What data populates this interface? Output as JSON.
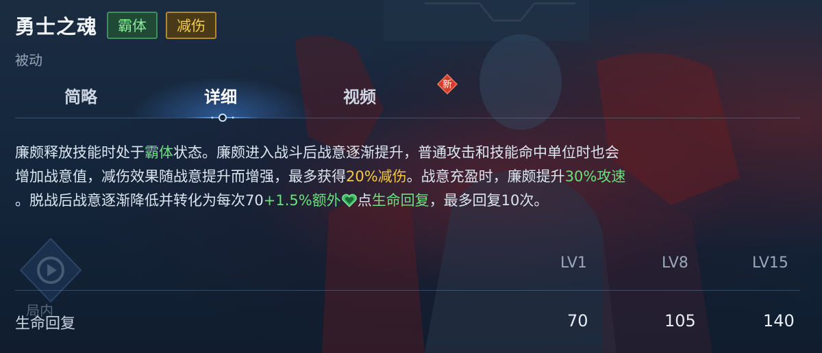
{
  "skill": {
    "name": "勇士之魂",
    "tags": [
      "霸体",
      "减伤"
    ],
    "type": "被动"
  },
  "tabs": [
    {
      "label": "简略",
      "active": false
    },
    {
      "label": "详细",
      "active": true
    },
    {
      "label": "视频",
      "active": false
    }
  ],
  "new_badge": "新",
  "description": {
    "line1_a": "廉颇释放技能时处于",
    "line1_hl": "霸体",
    "line1_b": "状态。廉颇进入战斗后战意逐渐提升，普通攻击和技能命中单位时也会",
    "line2_a": "增加战意值，减伤效果随战意提升而增强，最多获得",
    "line2_hl": "20%减伤",
    "line2_b": "。战意充盈时，廉颇提升",
    "line2_hl2": "30%攻速",
    "line3_a": "。脱战后战意逐渐降低并转化为每次70",
    "line3_hl": "+1.5%额外",
    "line3_b": "点",
    "line3_hl2": "生命回复",
    "line3_c": "，最多回复10次。"
  },
  "levels": [
    "LV1",
    "LV8",
    "LV15"
  ],
  "stats": [
    {
      "label": "生命回复",
      "values": [
        "70",
        "105",
        "140"
      ]
    }
  ],
  "side_button": {
    "label": "局内"
  },
  "colors": {
    "green": "#6be07e",
    "gold": "#f2c94c",
    "accent_blue": "#4a9dff"
  }
}
